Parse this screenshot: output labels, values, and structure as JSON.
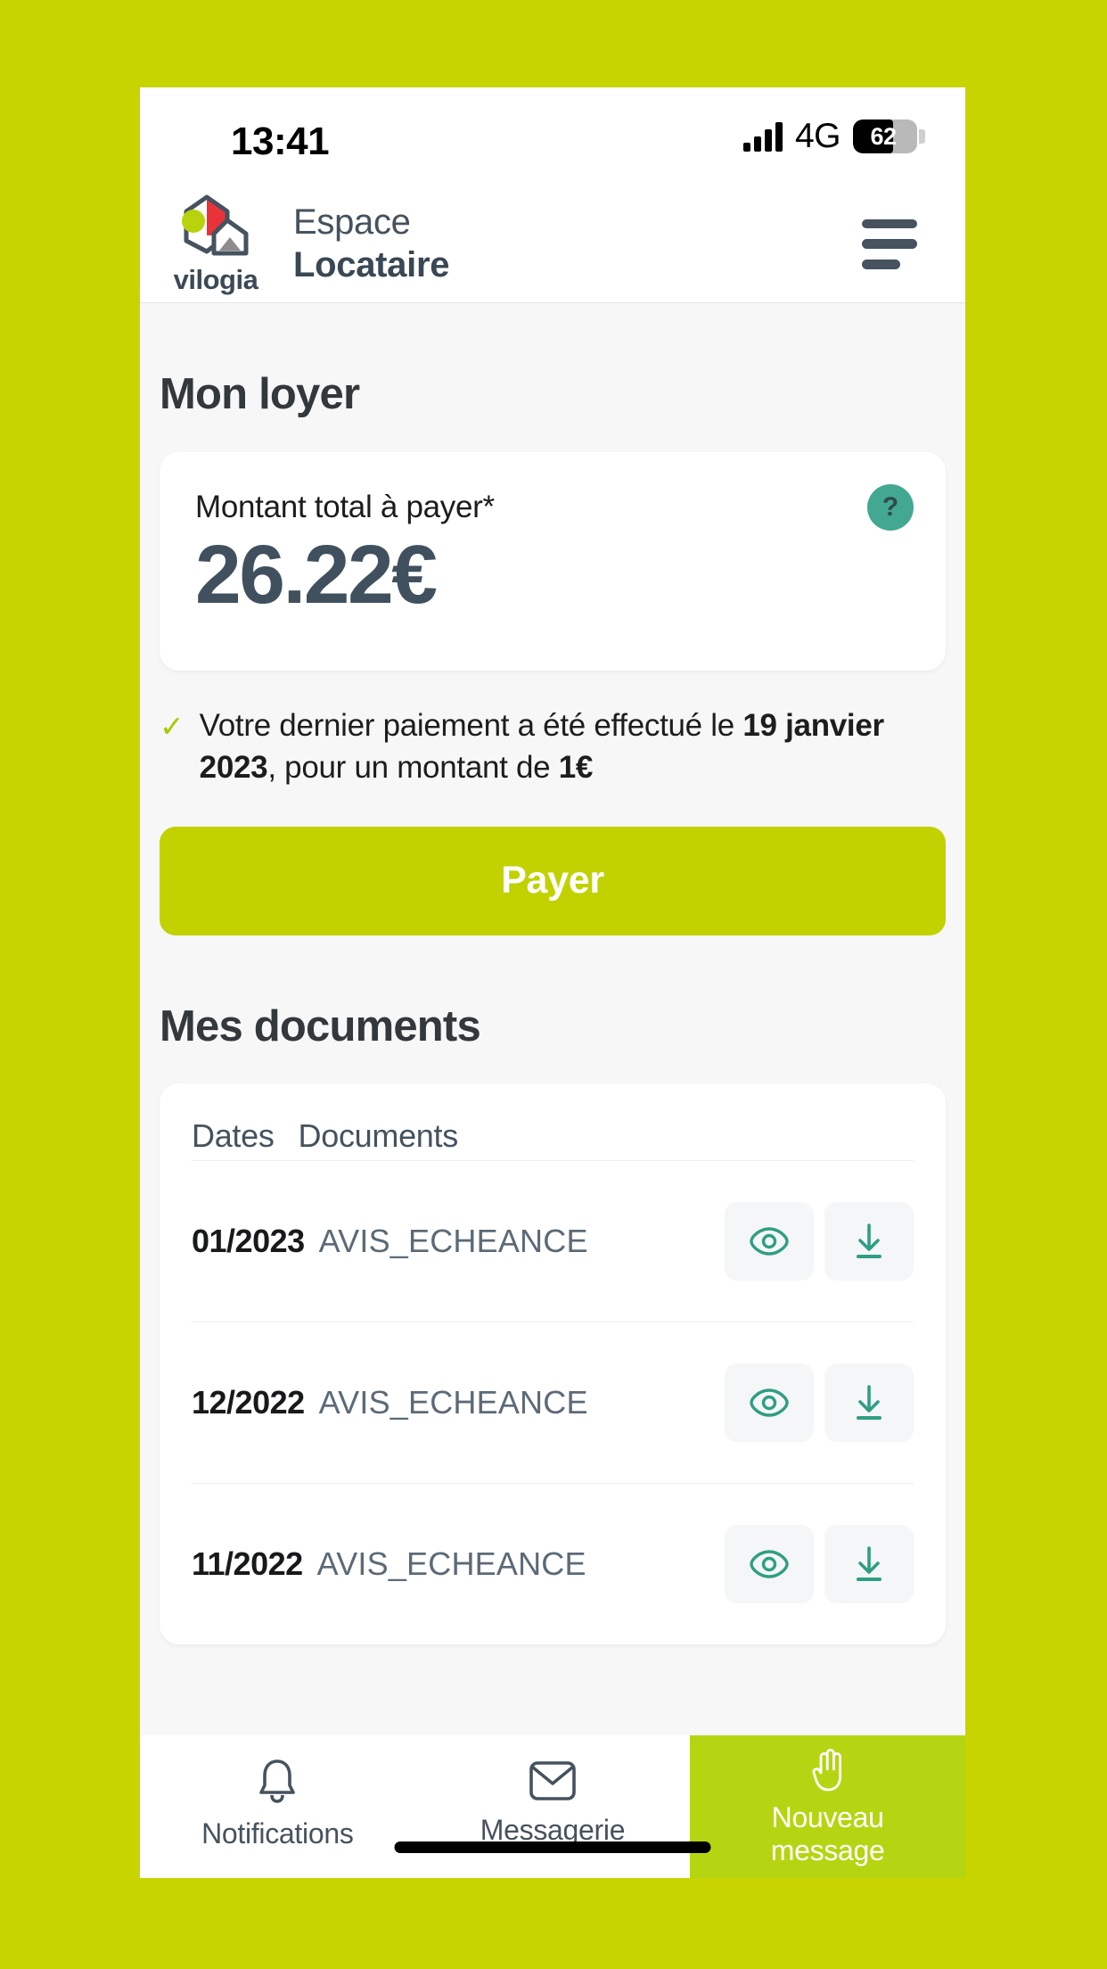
{
  "theme": {
    "page_background": "#c8d400",
    "brand_green": "#c2d100",
    "accent_green": "#b5d512",
    "slate": "#46525e",
    "teal": "#2f9e84",
    "help_badge": "#43a891"
  },
  "status_bar": {
    "time": "13:41",
    "network": "4G",
    "battery_percent": "62",
    "signal_icon": "signal-bars-icon",
    "battery_icon": "battery-icon"
  },
  "header": {
    "logo_word": "vilogia",
    "logo_icon": "vilogia-house-logo",
    "title_line1": "Espace",
    "title_line2": "Locataire",
    "menu_icon": "hamburger-menu-icon"
  },
  "rent": {
    "section_title": "Mon loyer",
    "amount_label": "Montant total à payer*",
    "amount_value": "26.22€",
    "help_icon": "question-mark-icon",
    "help_label": "?",
    "check_icon": "check-icon",
    "last_payment": {
      "prefix": "Votre dernier paiement a été effectué le ",
      "date": "19 janvier 2023",
      "middle": ", pour un montant de ",
      "amount": "1€"
    },
    "pay_button": "Payer"
  },
  "documents": {
    "section_title": "Mes documents",
    "columns": [
      "Dates",
      "Documents"
    ],
    "view_icon": "eye-icon",
    "download_icon": "download-icon",
    "rows": [
      {
        "date": "01/2023",
        "name": "AVIS_ECHEANCE"
      },
      {
        "date": "12/2022",
        "name": "AVIS_ECHEANCE"
      },
      {
        "date": "11/2022",
        "name": "AVIS_ECHEANCE"
      }
    ]
  },
  "bottom_nav": [
    {
      "label": "Notifications",
      "icon": "bell-icon"
    },
    {
      "label": "Messagerie",
      "icon": "envelope-icon"
    },
    {
      "label": "Nouveau\nmessage",
      "label_line1": "Nouveau",
      "label_line2": "message",
      "icon": "raised-hand-icon"
    }
  ]
}
